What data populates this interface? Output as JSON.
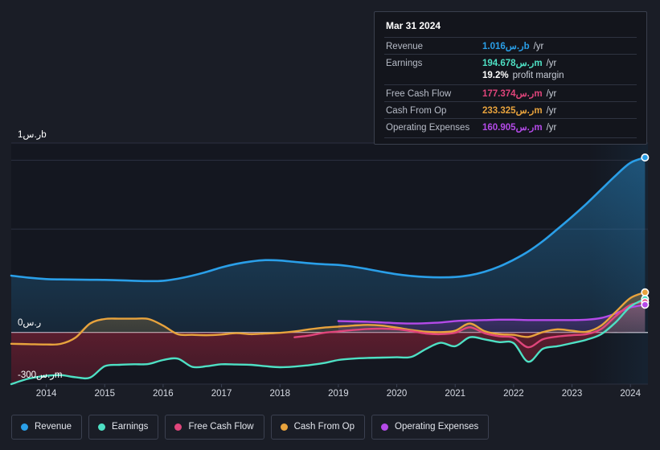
{
  "tooltip": {
    "title": "Mar 31 2024",
    "rows": [
      {
        "label": "Revenue",
        "value": "1.016ر.سb",
        "suffix": "/yr",
        "color": "#2a9fe8"
      },
      {
        "label": "Earnings",
        "value": "194.678ر.سm",
        "suffix": "/yr",
        "color": "#4ee0c4"
      },
      {
        "label": "Free Cash Flow",
        "value": "177.374ر.سm",
        "suffix": "/yr",
        "color": "#e0457b"
      },
      {
        "label": "Cash From Op",
        "value": "233.325ر.سm",
        "suffix": "/yr",
        "color": "#e8a33d"
      },
      {
        "label": "Operating Expenses",
        "value": "160.905ر.سm",
        "suffix": "/yr",
        "color": "#b44ae8"
      }
    ],
    "profit_margin_value": "19.2%",
    "profit_margin_label": "profit margin"
  },
  "legend": [
    {
      "label": "Revenue",
      "color": "#2a9fe8"
    },
    {
      "label": "Earnings",
      "color": "#4ee0c4"
    },
    {
      "label": "Free Cash Flow",
      "color": "#e0457b"
    },
    {
      "label": "Cash From Op",
      "color": "#e8a33d"
    },
    {
      "label": "Operating Expenses",
      "color": "#b44ae8"
    }
  ],
  "axes": {
    "y_labels": [
      "1ر.سb",
      "0ر.س",
      "-300ر.سm"
    ],
    "x_labels": [
      "2014",
      "2015",
      "2016",
      "2017",
      "2018",
      "2019",
      "2020",
      "2021",
      "2022",
      "2023",
      "2024"
    ]
  },
  "chart_data": {
    "type": "area",
    "title": "",
    "xlabel": "",
    "ylabel": "",
    "ylim": [
      -300000000,
      1100000000
    ],
    "xlim": [
      2013.4,
      2024.3
    ],
    "grid": true,
    "legend_position": "bottom",
    "currency": "ر.س",
    "x": [
      2013.4,
      2013.7,
      2014.0,
      2014.25,
      2014.5,
      2014.75,
      2015.0,
      2015.25,
      2015.5,
      2015.75,
      2016.0,
      2016.25,
      2016.5,
      2016.75,
      2017.0,
      2017.25,
      2017.5,
      2017.75,
      2018.0,
      2018.25,
      2018.5,
      2018.75,
      2019.0,
      2019.25,
      2019.5,
      2019.75,
      2020.0,
      2020.25,
      2020.5,
      2020.75,
      2021.0,
      2021.25,
      2021.5,
      2021.75,
      2022.0,
      2022.25,
      2022.5,
      2022.75,
      2023.0,
      2023.25,
      2023.5,
      2023.75,
      2024.0,
      2024.25
    ],
    "series": [
      {
        "name": "Revenue",
        "color": "#2a9fe8",
        "values": [
          330,
          318,
          310,
          308,
          307,
          306,
          305,
          303,
          300,
          298,
          300,
          312,
          330,
          352,
          378,
          398,
          412,
          420,
          418,
          410,
          402,
          396,
          392,
          382,
          368,
          352,
          338,
          328,
          322,
          320,
          322,
          332,
          352,
          382,
          422,
          470,
          530,
          600,
          672,
          748,
          830,
          912,
          985,
          1016
        ]
      },
      {
        "name": "Earnings",
        "color": "#4ee0c4",
        "values": [
          -300,
          -268,
          -252,
          -248,
          -260,
          -262,
          -196,
          -188,
          -185,
          -183,
          -160,
          -152,
          -200,
          -196,
          -185,
          -186,
          -188,
          -196,
          -202,
          -198,
          -190,
          -178,
          -160,
          -152,
          -148,
          -146,
          -144,
          -142,
          -96,
          -60,
          -80,
          -28,
          -40,
          -56,
          -62,
          -170,
          -95,
          -80,
          -62,
          -42,
          -10,
          60,
          150,
          195
        ]
      },
      {
        "name": "Free Cash Flow",
        "color": "#e0457b",
        "values": [
          null,
          null,
          null,
          null,
          null,
          null,
          null,
          null,
          null,
          null,
          null,
          null,
          null,
          null,
          null,
          null,
          null,
          null,
          null,
          -28,
          -18,
          -2,
          6,
          14,
          20,
          22,
          18,
          8,
          -6,
          -10,
          -2,
          30,
          -4,
          -22,
          -30,
          -86,
          -40,
          -24,
          -16,
          -10,
          20,
          95,
          160,
          177
        ]
      },
      {
        "name": "Cash From Op",
        "color": "#e8a33d",
        "values": [
          -66,
          -68,
          -70,
          -66,
          -30,
          52,
          78,
          80,
          80,
          78,
          40,
          -10,
          -14,
          -16,
          -12,
          -4,
          -10,
          -6,
          -2,
          6,
          18,
          28,
          34,
          40,
          44,
          40,
          28,
          14,
          4,
          2,
          10,
          52,
          8,
          -10,
          -14,
          -26,
          2,
          18,
          10,
          4,
          40,
          120,
          200,
          233
        ]
      },
      {
        "name": "Operating Expenses",
        "color": "#b44ae8",
        "values": [
          null,
          null,
          null,
          null,
          null,
          null,
          null,
          null,
          null,
          null,
          null,
          null,
          null,
          null,
          null,
          null,
          null,
          null,
          null,
          null,
          null,
          null,
          66,
          64,
          62,
          58,
          54,
          52,
          54,
          58,
          66,
          70,
          72,
          74,
          74,
          72,
          72,
          72,
          72,
          74,
          84,
          110,
          145,
          161
        ]
      }
    ]
  }
}
